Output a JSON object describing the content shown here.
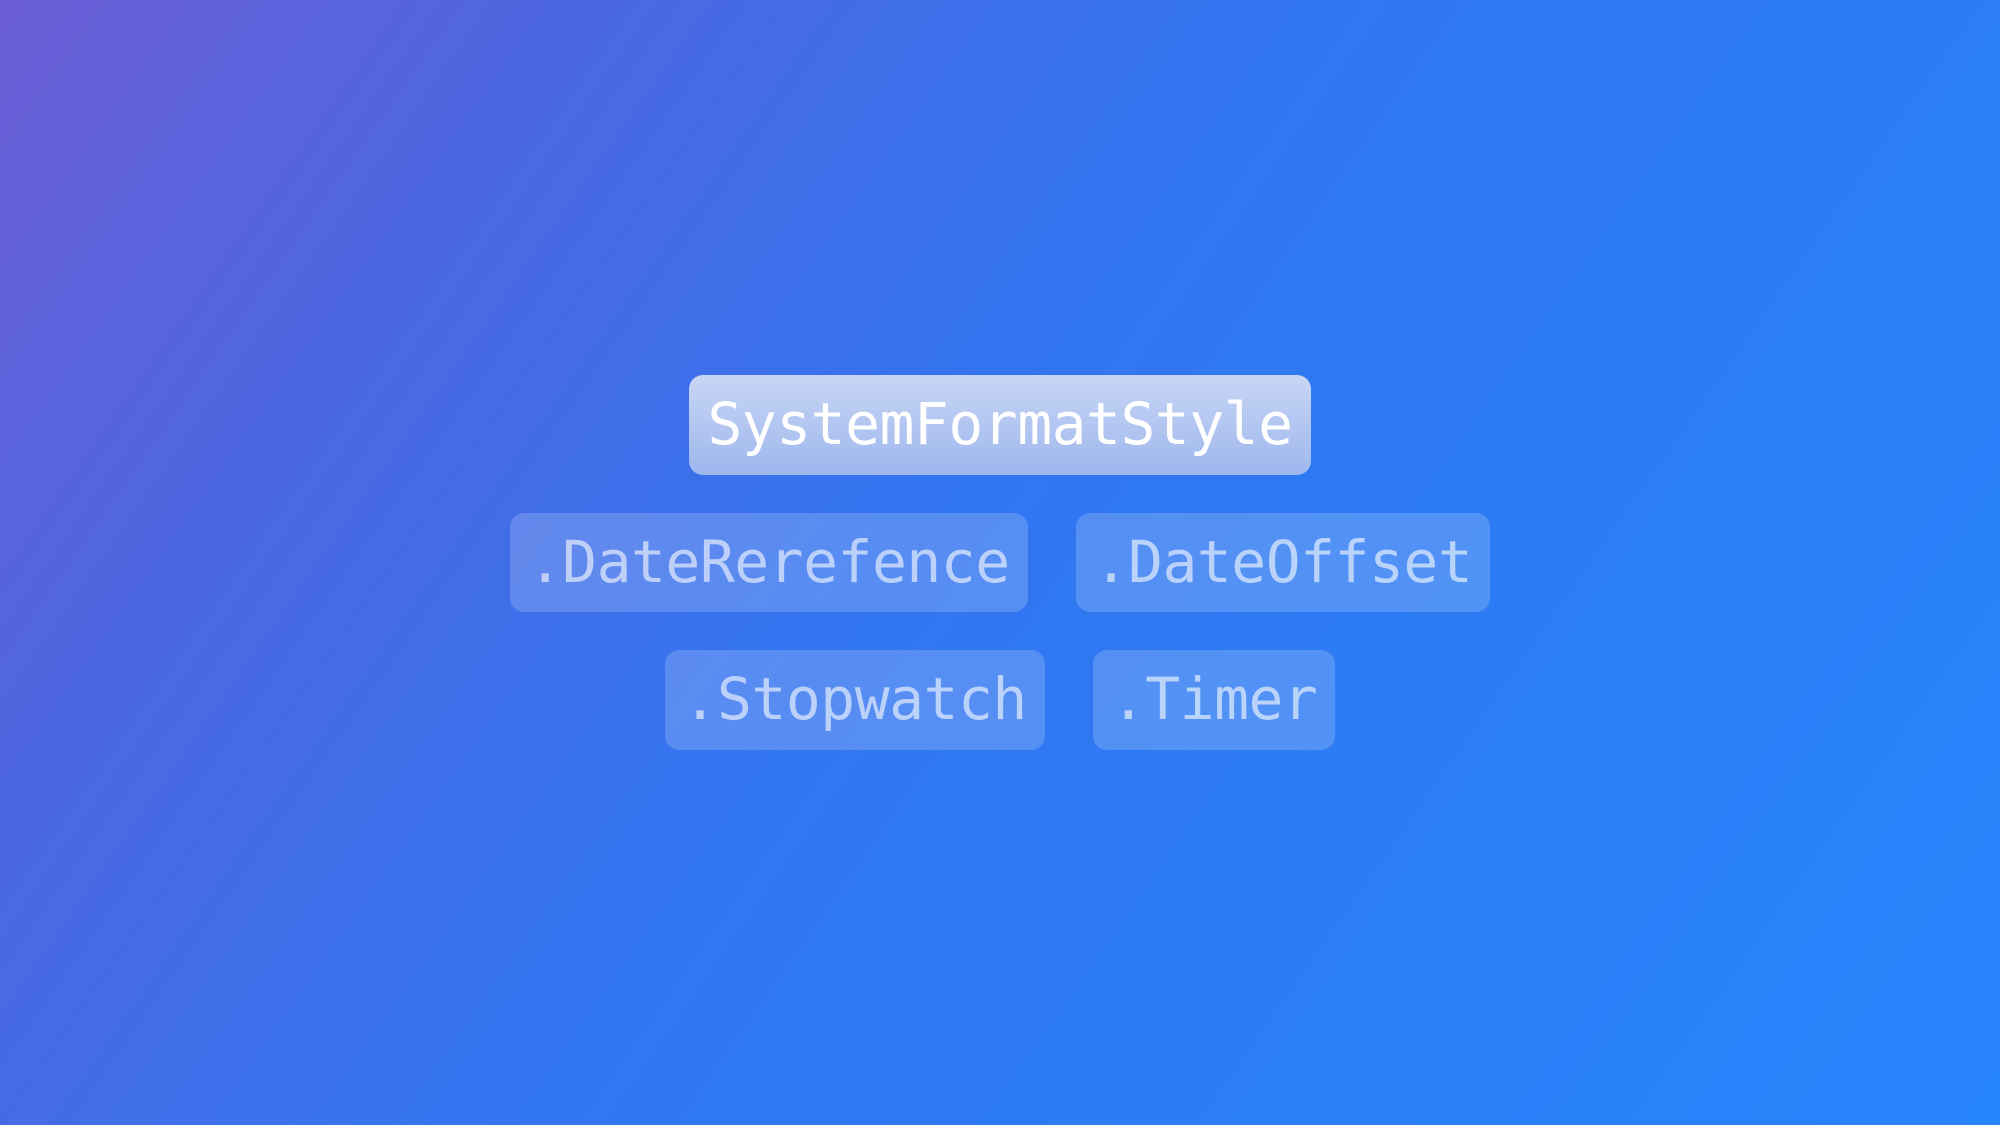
{
  "parent": {
    "label": "SystemFormatStyle"
  },
  "children_row1": [
    {
      "label": ".DateRerefence"
    },
    {
      "label": ".DateOffset"
    }
  ],
  "children_row2": [
    {
      "label": ".Stopwatch"
    },
    {
      "label": ".Timer"
    }
  ]
}
